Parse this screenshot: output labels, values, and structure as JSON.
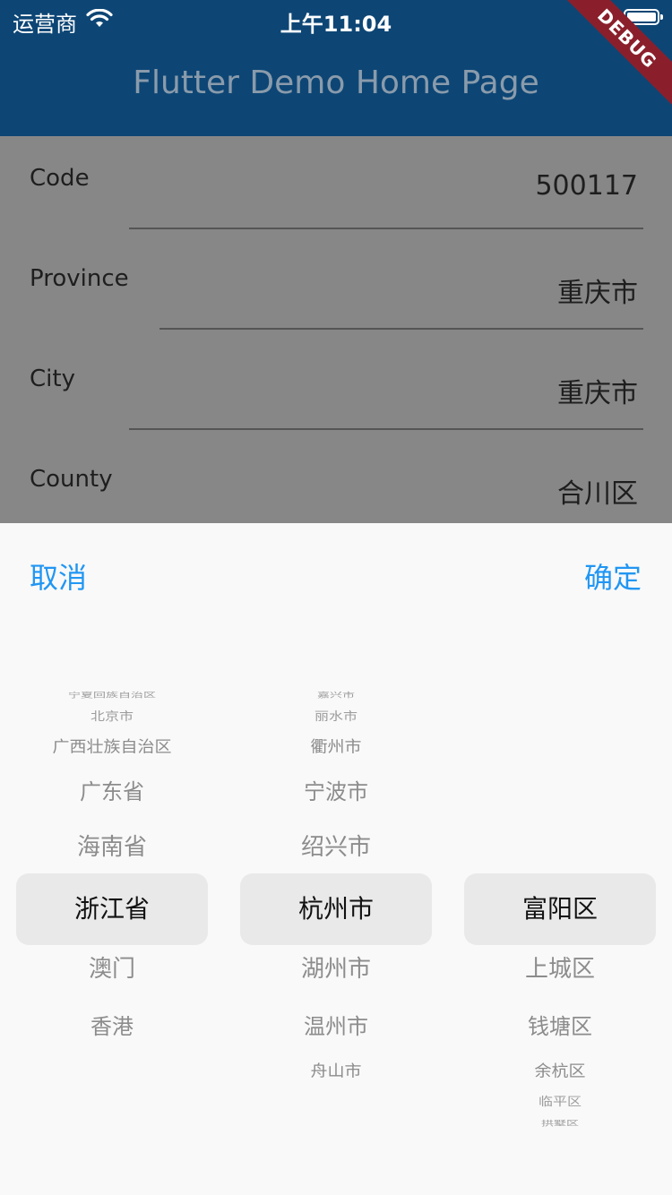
{
  "status_bar": {
    "carrier": "运营商",
    "time": "上午11:04"
  },
  "app_bar": {
    "title": "Flutter Demo Home Page",
    "debug_banner": "DEBUG"
  },
  "form": {
    "rows": [
      {
        "label": "Code",
        "value": "500117"
      },
      {
        "label": "Province",
        "value": "重庆市"
      },
      {
        "label": "City",
        "value": "重庆市"
      },
      {
        "label": "County",
        "value": "合川区"
      }
    ]
  },
  "picker": {
    "cancel_label": "取消",
    "confirm_label": "确定",
    "columns": [
      {
        "items": [
          "宁夏回族自治区",
          "北京市",
          "广西壮族自治区",
          "广东省",
          "海南省",
          "浙江省",
          "澳门",
          "香港"
        ],
        "selected_index": 5
      },
      {
        "items": [
          "嘉兴市",
          "丽水市",
          "衢州市",
          "宁波市",
          "绍兴市",
          "杭州市",
          "湖州市",
          "温州市",
          "舟山市"
        ],
        "selected_index": 5
      },
      {
        "items": [
          "富阳区",
          "上城区",
          "钱塘区",
          "余杭区",
          "临平区",
          "拱墅区"
        ],
        "selected_index": 0
      }
    ]
  },
  "colors": {
    "app_bar": "#0d4675",
    "accent": "#2196f3",
    "debug_banner": "#8a1f2b"
  }
}
